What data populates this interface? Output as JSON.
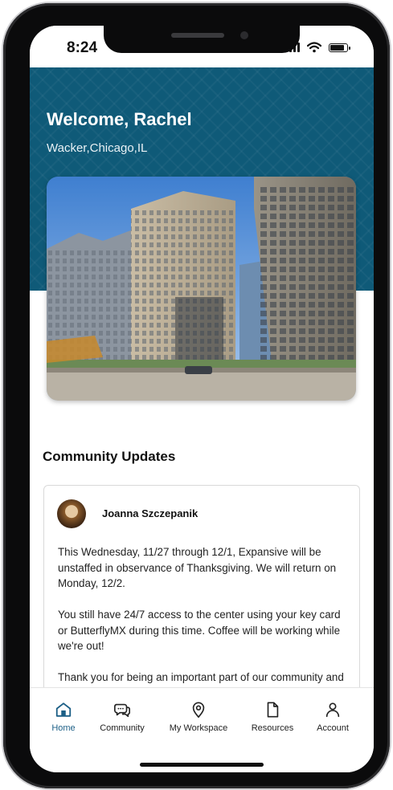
{
  "status_bar": {
    "time": "8:24"
  },
  "header": {
    "welcome": "Welcome, Rachel",
    "location": "Wacker,Chicago,IL"
  },
  "community": {
    "title": "Community Updates",
    "post": {
      "author": "Joanna Szczepanik",
      "paragraphs": [
        "This Wednesday, 11/27 through 12/1, Expansive will be unstaffed in observance of Thanksgiving. We will return on Monday, 12/2.",
        "You still have 24/7 access to the center using your key card or ButterflyMX during this time. Coffee will be working while we're out!",
        "Thank you for being an important part of our community and we hope you have a wonderful & safe holiday weekend!"
      ]
    }
  },
  "tabs": [
    {
      "label": "Home",
      "icon": "home-icon",
      "active": true
    },
    {
      "label": "Community",
      "icon": "chat-icon",
      "active": false
    },
    {
      "label": "My Workspace",
      "icon": "location-pin-icon",
      "active": false
    },
    {
      "label": "Resources",
      "icon": "document-icon",
      "active": false
    },
    {
      "label": "Account",
      "icon": "user-icon",
      "active": false
    }
  ],
  "colors": {
    "brand": "#0f5a78",
    "active_tab": "#1c5f86"
  }
}
